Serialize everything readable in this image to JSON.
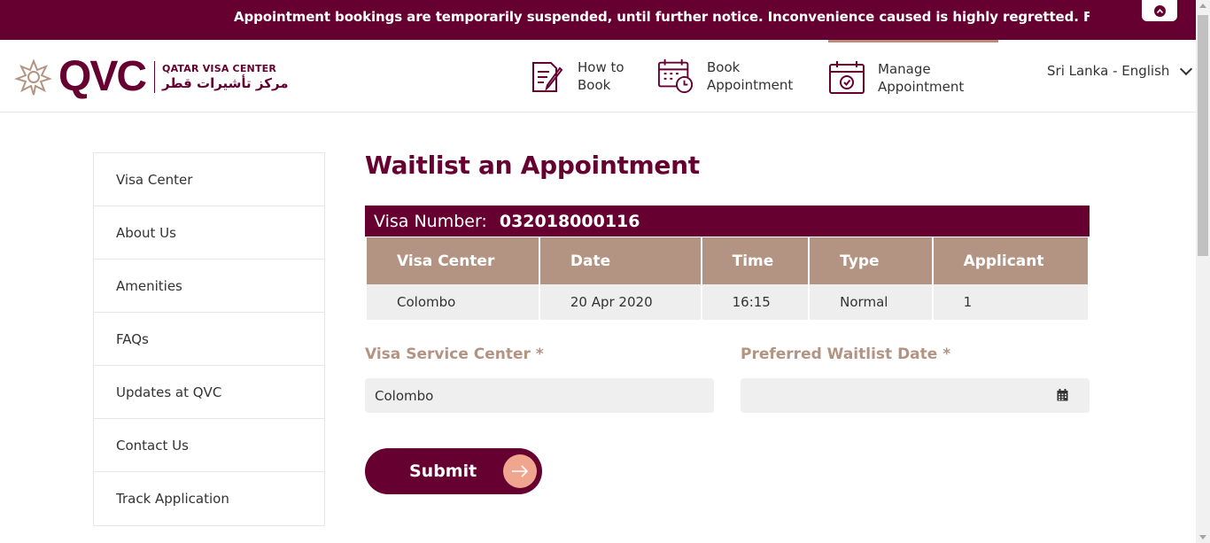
{
  "announcement": {
    "text": "Appointment bookings are temporarily suspended, until further notice. Inconvenience caused is highly regretted. For further inquiries, please"
  },
  "header": {
    "logo_text": "QVC",
    "logo_en": "QATAR VISA CENTER",
    "logo_ar": "مركز تأشيرات قطر",
    "nav": [
      {
        "label": "How to\nBook",
        "icon": "document-pen-icon"
      },
      {
        "label": "Book\nAppointment",
        "icon": "calendar-clock-icon"
      },
      {
        "label": "Manage\nAppointment",
        "icon": "calendar-check-icon",
        "active": true
      }
    ],
    "language": "Sri Lanka - English"
  },
  "sidebar": {
    "items": [
      {
        "label": "Visa Center"
      },
      {
        "label": "About Us"
      },
      {
        "label": "Amenities"
      },
      {
        "label": "FAQs"
      },
      {
        "label": "Updates at QVC"
      },
      {
        "label": "Contact Us"
      },
      {
        "label": "Track Application"
      }
    ]
  },
  "main": {
    "title": "Waitlist an Appointment",
    "visa_label": "Visa Number:",
    "visa_number": "032018000116",
    "table": {
      "headers": [
        "Visa Center",
        "Date",
        "Time",
        "Type",
        "Applicant"
      ],
      "rows": [
        [
          "Colombo",
          "20 Apr 2020",
          "16:15",
          "Normal",
          "1"
        ]
      ]
    },
    "service_center_label": "Visa Service Center *",
    "service_center_value": "Colombo",
    "waitlist_date_label": "Preferred Waitlist Date *",
    "waitlist_date_value": "",
    "submit_label": "Submit"
  },
  "colors": {
    "brand": "#650031",
    "accent": "#b39482",
    "arrow": "#f0a58e"
  }
}
